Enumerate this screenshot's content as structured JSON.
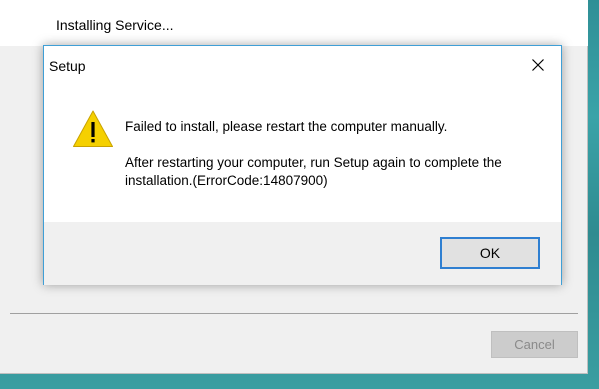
{
  "background_window": {
    "title": "Installing Service...",
    "cancel_label": "Cancel"
  },
  "dialog": {
    "title": "Setup",
    "icon": "warning-icon",
    "message_primary": "Failed to install, please restart the computer manually.",
    "message_secondary": "After restarting your computer, run Setup again to complete the installation.(ErrorCode:14807900)",
    "ok_label": "OK"
  },
  "colors": {
    "desktop": "#3aa3a8",
    "accent_border": "#2f7fd1",
    "warning_fill": "#f5d000"
  }
}
